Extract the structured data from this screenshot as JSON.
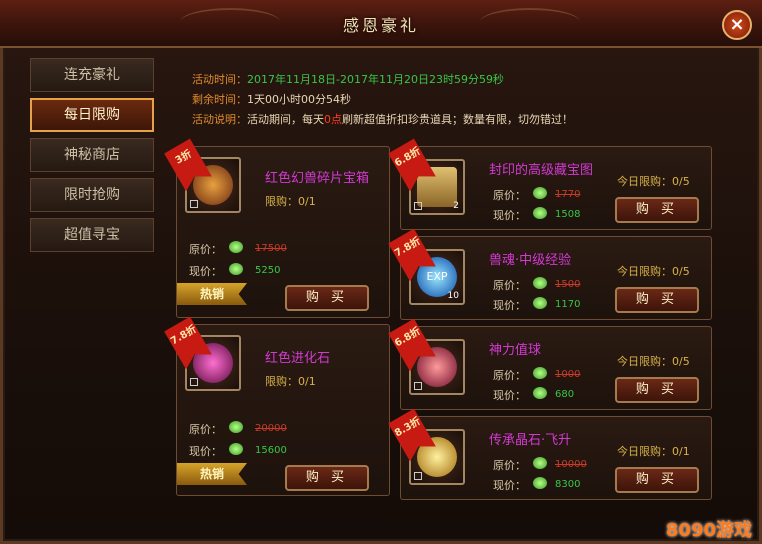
{
  "window": {
    "title": "感恩豪礼",
    "close_label": "×"
  },
  "sidebar": {
    "items": [
      {
        "label": "连充豪礼",
        "active": false
      },
      {
        "label": "每日限购",
        "active": true
      },
      {
        "label": "神秘商店",
        "active": false
      },
      {
        "label": "限时抢购",
        "active": false
      },
      {
        "label": "超值寻宝",
        "active": false
      }
    ]
  },
  "info": {
    "time_label": "活动时间：",
    "time_value": "2017年11月18日-2017年11月20日23时59分59秒",
    "remain_label": "剩余时间：",
    "remain_value": "1天00小时00分54秒",
    "desc_label": "活动说明：",
    "desc_a": "活动期间，每天",
    "desc_hl": "0点",
    "desc_b": "刷新超值折扣珍贵道具；数量有限，切勿错过！"
  },
  "labels": {
    "orig": "原价：",
    "now": "现价：",
    "buy": "购 买",
    "hot": "热销"
  },
  "left_items": [
    {
      "discount": "3折",
      "name": "红色幻兽碎片宝箱",
      "limit": "限购：0/1",
      "orig": "17500",
      "now": "5250",
      "hot": true,
      "qty": ""
    },
    {
      "discount": "7.8折",
      "name": "红色进化石",
      "limit": "限购：0/1",
      "orig": "20000",
      "now": "15600",
      "hot": true,
      "qty": ""
    }
  ],
  "right_items": [
    {
      "discount": "6.8折",
      "name": "封印的高级藏宝图",
      "limit": "今日限购：0/5",
      "orig": "1770",
      "now": "1508",
      "qty": "2"
    },
    {
      "discount": "7.8折",
      "name": "兽魂·中级经验",
      "limit": "今日限购：0/5",
      "orig": "1500",
      "now": "1170",
      "qty": "10"
    },
    {
      "discount": "6.8折",
      "name": "神力值球",
      "limit": "今日限购：0/5",
      "orig": "1000",
      "now": "680",
      "qty": ""
    },
    {
      "discount": "8.3折",
      "name": "传承晶石·飞升",
      "limit": "今日限购：0/1",
      "orig": "10000",
      "now": "8300",
      "qty": ""
    }
  ],
  "watermark": "8090游戏"
}
